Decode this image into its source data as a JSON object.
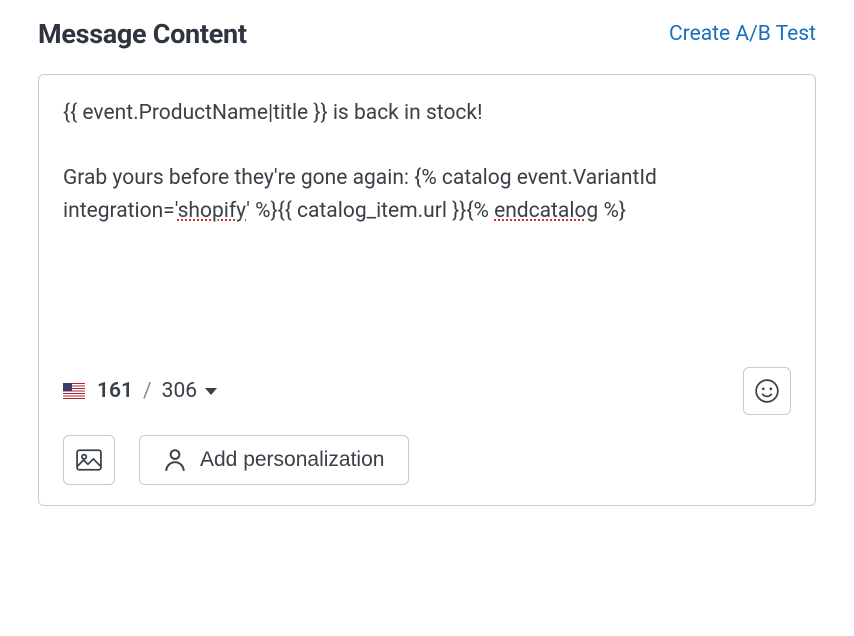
{
  "header": {
    "title": "Message Content",
    "create_ab_label": "Create A/B Test"
  },
  "message": {
    "text_parts": [
      {
        "t": "{{ event.ProductName|title }} is back in stock!\n\nGrab yours before they're gone again: {% catalog event.VariantId integration='",
        "spell": false
      },
      {
        "t": "shopify",
        "spell": true
      },
      {
        "t": "' %}{{ catalog_item.url }}{% ",
        "spell": false
      },
      {
        "t": "endcatalog",
        "spell": true
      },
      {
        "t": " %}",
        "spell": false
      }
    ]
  },
  "counter": {
    "current": "161",
    "separator": "/",
    "max": "306"
  },
  "buttons": {
    "personalization_label": "Add personalization"
  },
  "icons": {
    "flag": "us-flag-icon",
    "chevron": "chevron-down-icon",
    "emoji": "emoji-icon",
    "image": "image-icon",
    "person": "person-icon"
  }
}
